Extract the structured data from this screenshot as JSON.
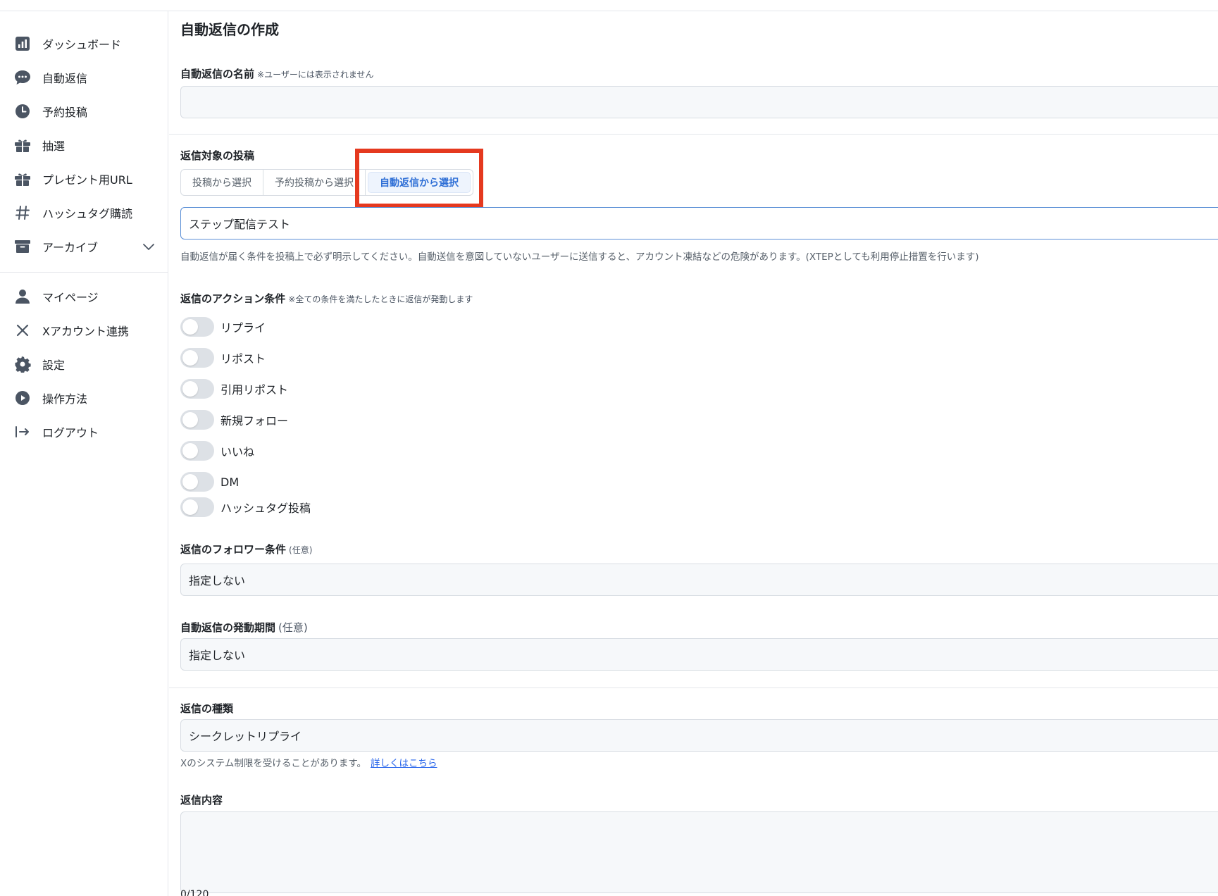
{
  "sidebar": {
    "items": [
      {
        "label": "ダッシュボード",
        "icon": "bar-chart-icon"
      },
      {
        "label": "自動返信",
        "icon": "chat-bubble-icon"
      },
      {
        "label": "予約投稿",
        "icon": "clock-icon"
      },
      {
        "label": "抽選",
        "icon": "gift-icon"
      },
      {
        "label": "プレゼント用URL",
        "icon": "gift-icon"
      },
      {
        "label": "ハッシュタグ購読",
        "icon": "hashtag-icon"
      },
      {
        "label": "アーカイブ",
        "icon": "archive-icon"
      }
    ],
    "bottom_items": [
      {
        "label": "マイページ",
        "icon": "person-icon"
      },
      {
        "label": "Xアカウント連携",
        "icon": "x-icon"
      },
      {
        "label": "設定",
        "icon": "gear-icon"
      },
      {
        "label": "操作方法",
        "icon": "play-circle-icon"
      },
      {
        "label": "ログアウト",
        "icon": "logout-icon"
      }
    ]
  },
  "main": {
    "title": "自動返信の作成",
    "name_section": {
      "label": "自動返信の名前",
      "note": "※ユーザーには表示されません",
      "value": ""
    },
    "target_section": {
      "label": "返信対象の投稿",
      "tabs": [
        "投稿から選択",
        "予約投稿から選択",
        "自動返信から選択"
      ],
      "active_tab": "自動返信から選択",
      "selected_value": "ステップ配信テスト",
      "help": "自動返信が届く条件を投稿上で必ず明示してください。自動送信を意図していないユーザーに送信すると、アカウント凍結などの危険があります。(XTEPとしても利用停止措置を行います)"
    },
    "action_section": {
      "label": "返信のアクション条件",
      "note": "※全ての条件を満たしたときに返信が発動します",
      "toggles": [
        {
          "label": "リプライ",
          "on": false
        },
        {
          "label": "リポスト",
          "on": false
        },
        {
          "label": "引用リポスト",
          "on": false
        },
        {
          "label": "新規フォロー",
          "on": false
        },
        {
          "label": "いいね",
          "on": false
        },
        {
          "label": "DM",
          "on": false
        },
        {
          "label": "ハッシュタグ投稿",
          "on": false
        }
      ]
    },
    "follower_section": {
      "label": "返信のフォロワー条件",
      "optional": "(任意)",
      "value": "指定しない"
    },
    "period_section": {
      "label": "自動返信の発動期間",
      "optional": "(任意)",
      "value": "指定しない"
    },
    "reply_type_section": {
      "label": "返信の種類",
      "value": "シークレットリプライ",
      "help": "Xのシステム制限を受けることがあります。",
      "help_link": "詳しくはこちら"
    },
    "content_section": {
      "label": "返信内容",
      "counter": "0/120"
    }
  },
  "colors": {
    "accent": "#2f6fd6",
    "highlight": "#e5391f",
    "field_bg": "#f6f8fa",
    "toggle_off": "#dde1e6"
  }
}
